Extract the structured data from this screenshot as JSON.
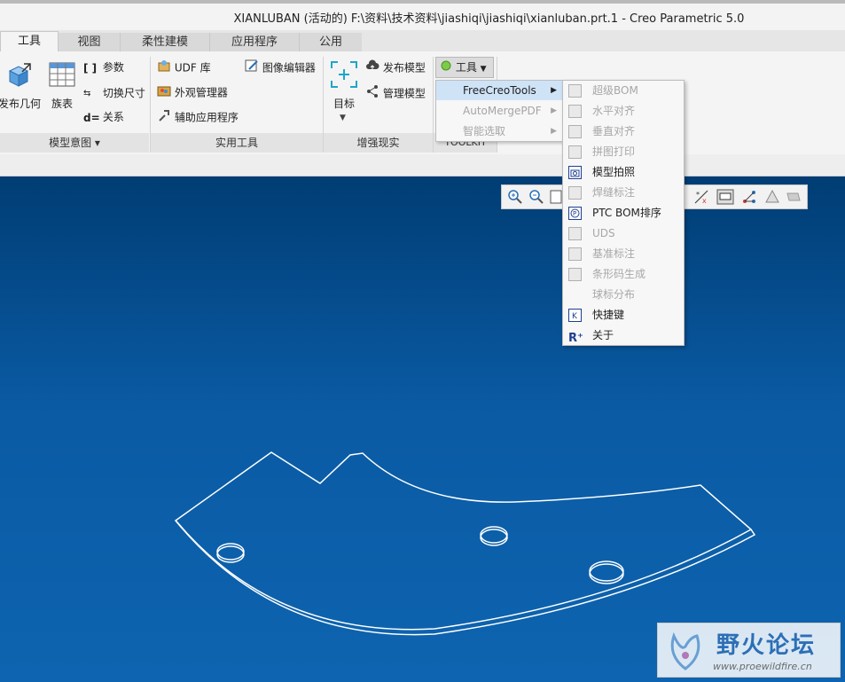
{
  "window": {
    "title": "XIANLUBAN (活动的) F:\\资料\\技术资料\\jiashiqi\\jiashiqi\\xianluban.prt.1 - Creo Parametric 5.0"
  },
  "tabs": [
    {
      "label": "工具",
      "active": true
    },
    {
      "label": "视图",
      "active": false
    },
    {
      "label": "柔性建模",
      "active": false
    },
    {
      "label": "应用程序",
      "active": false
    },
    {
      "label": "公用",
      "active": false
    }
  ],
  "ribbon": {
    "model_intent": {
      "publish_geometry": "发布几何",
      "family_table": "族表",
      "parameters": "参数",
      "switch_dimensions": "切换尺寸",
      "relations": "关系",
      "group_label": "模型意图"
    },
    "utilities": {
      "udf_library": "UDF 库",
      "appearance_manager": "外观管理器",
      "auxiliary_app": "辅助应用程序",
      "image_editor": "图像编辑器",
      "group_label": "实用工具"
    },
    "augmented_reality": {
      "target": "目标",
      "publish_model": "发布模型",
      "manage_model": "管理模型",
      "group_label": "增强现实"
    },
    "toolkit": {
      "tools_button": "工具",
      "group_label": "TOOLKIT"
    }
  },
  "menu_level1": [
    {
      "label": "FreeCreoTools",
      "highlighted": true,
      "enabled": true
    },
    {
      "label": "AutoMergePDF",
      "highlighted": false,
      "enabled": false
    },
    {
      "label": "智能选取",
      "highlighted": false,
      "enabled": false
    }
  ],
  "menu_level2": [
    {
      "label": "超级BOM",
      "enabled": false
    },
    {
      "label": "水平对齐",
      "enabled": false
    },
    {
      "label": "垂直对齐",
      "enabled": false
    },
    {
      "label": "拼图打印",
      "enabled": false
    },
    {
      "label": "模型拍照",
      "enabled": true
    },
    {
      "label": "焊缝标注",
      "enabled": false
    },
    {
      "label": "PTC BOM排序",
      "enabled": true
    },
    {
      "label": "UDS",
      "enabled": false
    },
    {
      "label": "基准标注",
      "enabled": false
    },
    {
      "label": "条形码生成",
      "enabled": false
    },
    {
      "label": "球标分布",
      "enabled": false
    },
    {
      "label": "快捷键",
      "enabled": true
    },
    {
      "label": "关于",
      "enabled": true
    }
  ],
  "watermark": {
    "logo_text": "野火论坛",
    "url": "www.proewildfire.cn"
  },
  "colors": {
    "viewport_top": "#003d74",
    "viewport_bottom": "#0e64b0",
    "menu_highlight": "#cfe3f7",
    "accent_icon": "#1e6fc8"
  }
}
